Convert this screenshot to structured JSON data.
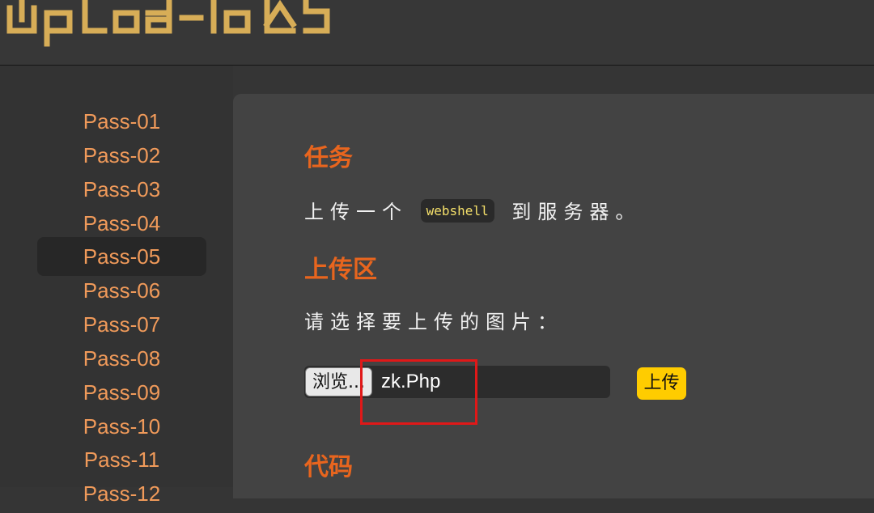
{
  "header": {
    "logo_text": "upload-labs"
  },
  "sidebar": {
    "items": [
      {
        "label": "Pass-01"
      },
      {
        "label": "Pass-02"
      },
      {
        "label": "Pass-03"
      },
      {
        "label": "Pass-04"
      },
      {
        "label": "Pass-05",
        "active": true
      },
      {
        "label": "Pass-06"
      },
      {
        "label": "Pass-07"
      },
      {
        "label": "Pass-08"
      },
      {
        "label": "Pass-09"
      },
      {
        "label": "Pass-10"
      },
      {
        "label": "Pass-11"
      },
      {
        "label": "Pass-12"
      }
    ]
  },
  "main": {
    "task": {
      "title": "任务",
      "text_before": "上传一个",
      "code": "webshell",
      "text_after": "到服务器。"
    },
    "upload_area": {
      "title": "上传区",
      "prompt": "请选择要上传的图片：",
      "browse_label": "浏览...",
      "file_name": "zk.Php",
      "submit_label": "上传"
    },
    "code_section": {
      "title": "代码"
    }
  },
  "colors": {
    "accent_orange": "#e8651e",
    "nav_link": "#f09a5a",
    "logo_gold": "#d7ad57",
    "upload_button": "#ffcc00",
    "annotation_red": "#e01818"
  }
}
